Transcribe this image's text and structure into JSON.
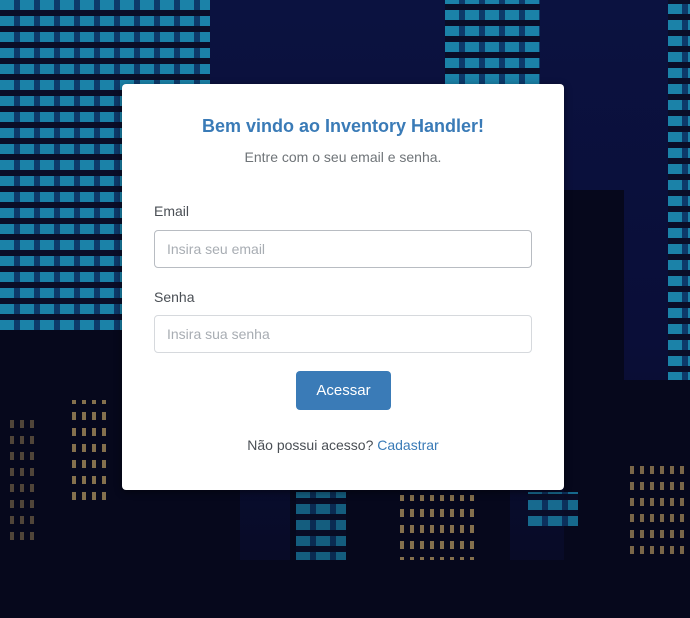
{
  "login": {
    "title": "Bem vindo ao Inventory Handler!",
    "subtitle": "Entre com o seu email e senha.",
    "email_label": "Email",
    "email_placeholder": "Insira seu email",
    "email_value": "",
    "password_label": "Senha",
    "password_placeholder": "Insira sua senha",
    "password_value": "",
    "submit_label": "Acessar",
    "no_access_text": "Não possui acesso?",
    "register_link": "Cadastrar"
  },
  "colors": {
    "accent": "#3a7bb7",
    "card_background": "#ffffff",
    "page_background": "#0a0d2e"
  }
}
